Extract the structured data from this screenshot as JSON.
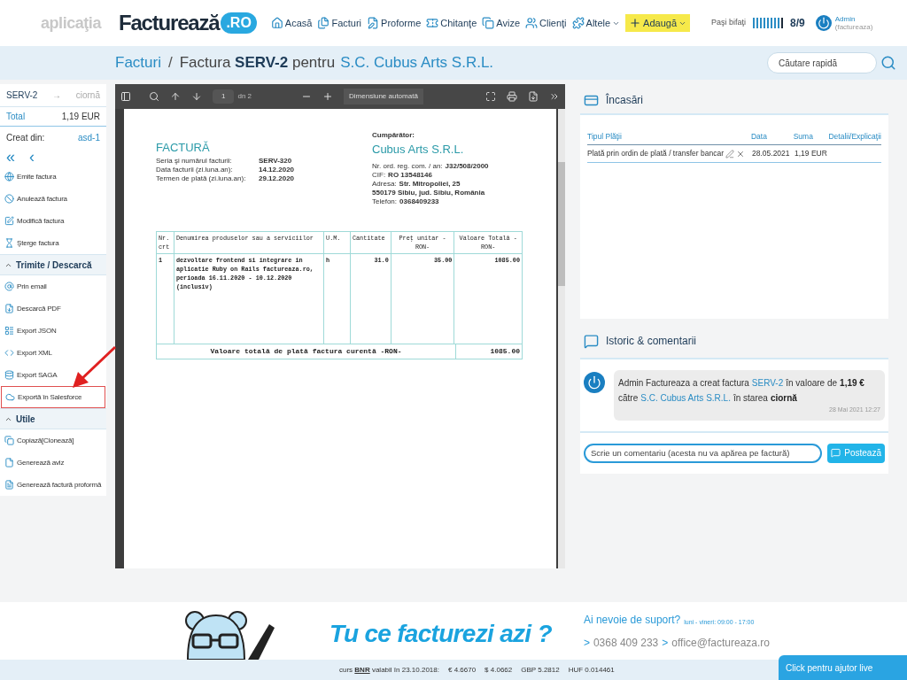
{
  "header": {
    "logo_left": "aplicaţia",
    "logo": "Facturează",
    "logo_badge": ".RO",
    "nav": [
      {
        "label": "Acasă",
        "kind": "link"
      },
      {
        "label": "Facturi",
        "kind": "link"
      },
      {
        "label": "Proforme",
        "kind": "link"
      },
      {
        "label": "Chitanţe",
        "kind": "link"
      },
      {
        "label": "Avize",
        "kind": "link"
      },
      {
        "label": "Clienţi",
        "kind": "link"
      },
      {
        "label": "Altele",
        "kind": "dropdown"
      },
      {
        "label": "Adaugă",
        "kind": "add"
      }
    ],
    "progress": {
      "label": "Paşi bifaţi",
      "steps": [
        {
          "done": true
        },
        {
          "done": true
        },
        {
          "done": true
        },
        {
          "done": true
        },
        {
          "done": true
        },
        {
          "done": true
        },
        {
          "done": true
        },
        {
          "done": true
        },
        {
          "done": false
        }
      ],
      "count": "8/9"
    },
    "user": {
      "name": "Admin",
      "org": "(factureaza)"
    }
  },
  "breadcrumb": {
    "root": "Facturi",
    "separator": "/",
    "title": "Factura **SERV-2** pentru",
    "client": "S.C. Cubus Arts S.R.L."
  },
  "search": {
    "placeholder": "Căutare rapidă"
  },
  "sidebar": {
    "number": "SERV-2",
    "arrow": "→",
    "status": "ciornă",
    "total_label": "Total",
    "total": "1,19 EUR",
    "created_label": "Creat din:",
    "created": "asd-1",
    "nav": [
      "«",
      "‹"
    ],
    "sections": [
      {
        "items": [
          {
            "label": "Emite factura",
            "highlighted": false
          },
          {
            "label": "Anulează factura",
            "highlighted": false
          },
          {
            "label": "Modifică factura",
            "highlighted": false
          },
          {
            "label": "Şterge factura",
            "highlighted": false
          }
        ]
      },
      {
        "title": "Trimite / Descarcă",
        "expanded": true,
        "items": [
          {
            "label": "Prin email",
            "highlighted": false
          },
          {
            "label": "Descarcă PDF",
            "highlighted": false
          },
          {
            "label": "Export JSON",
            "highlighted": false
          },
          {
            "label": "Export XML",
            "highlighted": false
          },
          {
            "label": "Export SAGA",
            "highlighted": false
          },
          {
            "label": "Exportă în Salesforce",
            "highlighted": true
          }
        ]
      },
      {
        "title": "Utile",
        "expanded": true,
        "items": [
          {
            "label": "Copiază[Clonează]",
            "highlighted": false
          },
          {
            "label": "Generează aviz",
            "highlighted": false
          },
          {
            "label": "Generează factură proformă",
            "highlighted": false
          }
        ]
      }
    ]
  },
  "pdf_viewer": {
    "page": "1",
    "page_count": "dn 2",
    "zoom": "Dimensiune automată",
    "invoice": {
      "title": "FACTURĂ",
      "fields": [
        {
          "label": "Seria şi numărul facturii:",
          "value": "SERV-320"
        },
        {
          "label": "Data facturii (zi.luna.an):",
          "value": "14.12.2020"
        },
        {
          "label": "Termen de plată (zi.luna.an):",
          "value": "29.12.2020"
        }
      ],
      "buyer_label": "Cumpărător:",
      "buyer": "Cubus Arts S.R.L.",
      "buyer_fields": [
        {
          "label": "Nr. ord. reg. com. / an:",
          "value": "J32/508/2000"
        },
        {
          "label": "CIF:",
          "value": "RO 13548146"
        },
        {
          "label": "Adresa:",
          "value": "Str. Mitropoliei, 25"
        },
        {
          "value": "550179 Sibiu, jud. Sibiu, România"
        },
        {
          "label": "Telefon:",
          "value": "0368409233"
        }
      ],
      "table": {
        "columns": [
          "Nr. crt",
          "Denumirea produselor sau a serviciilor",
          "U.M.",
          "Cantitate",
          "Preţ unitar -RON-",
          "Valoare Totală -RON-"
        ],
        "rows": [
          [
            "1",
            "dezvoltare frontend si integrare in aplicatie Ruby on Rails factureaza.ro, perioada 16.11.2020 - 10.12.2020 (inclusiv)",
            "h",
            "31.0",
            "35.00",
            "1085.00"
          ]
        ],
        "total_label": "Valoare totală de plată factura curentă  -RON-",
        "total": "1085.00"
      }
    }
  },
  "payments": {
    "title": "Încasări",
    "columns": [
      "Tipul Plăţii",
      "Data",
      "Suma",
      "Detalii/Explicaţii"
    ],
    "rows": [
      {
        "type": "Plată prin ordin de plată / transfer bancar",
        "date": "28.05.2021",
        "amount": "1,19 EUR"
      }
    ]
  },
  "history": {
    "title": "Istoric & comentarii",
    "entries": [
      {
        "parts": [
          {
            "kind": "text",
            "text": "Admin Factureaza a creat factura"
          },
          {
            "kind": "link",
            "text": "SERV-2"
          },
          {
            "kind": "text",
            "text": "în valoare de"
          },
          {
            "kind": "bold",
            "text": "1,19 €"
          },
          {
            "kind": "text",
            "text": "către"
          },
          {
            "kind": "link",
            "text": "S.C. Cubus Arts S.R.L."
          },
          {
            "kind": "text",
            "text": "în starea"
          },
          {
            "kind": "bold",
            "text": "ciornă"
          }
        ],
        "time": "28 Mai 2021 12:27"
      }
    ],
    "comment_placeholder": "Scrie un comentariu (acesta nu va apărea pe factură)",
    "post_button": "Postează"
  },
  "footer": {
    "slogan": "Tu ce facturezi azi ?",
    "support": "Ai nevoie de suport?",
    "hours": "luni - vineri: 09:00 - 17:00",
    "contacts": [
      {
        "marker": ">",
        "text": "0368 409 233"
      },
      {
        "marker": ">",
        "text": "office@factureaza.ro"
      }
    ],
    "rates_label": "curs **BNR** valabil în 23.10.2018:",
    "rates": [
      "€ 4.6670",
      "$ 4.0662",
      "GBP 5.2812",
      "HUF 0.014461"
    ],
    "help": "Click pentru ajutor live"
  }
}
